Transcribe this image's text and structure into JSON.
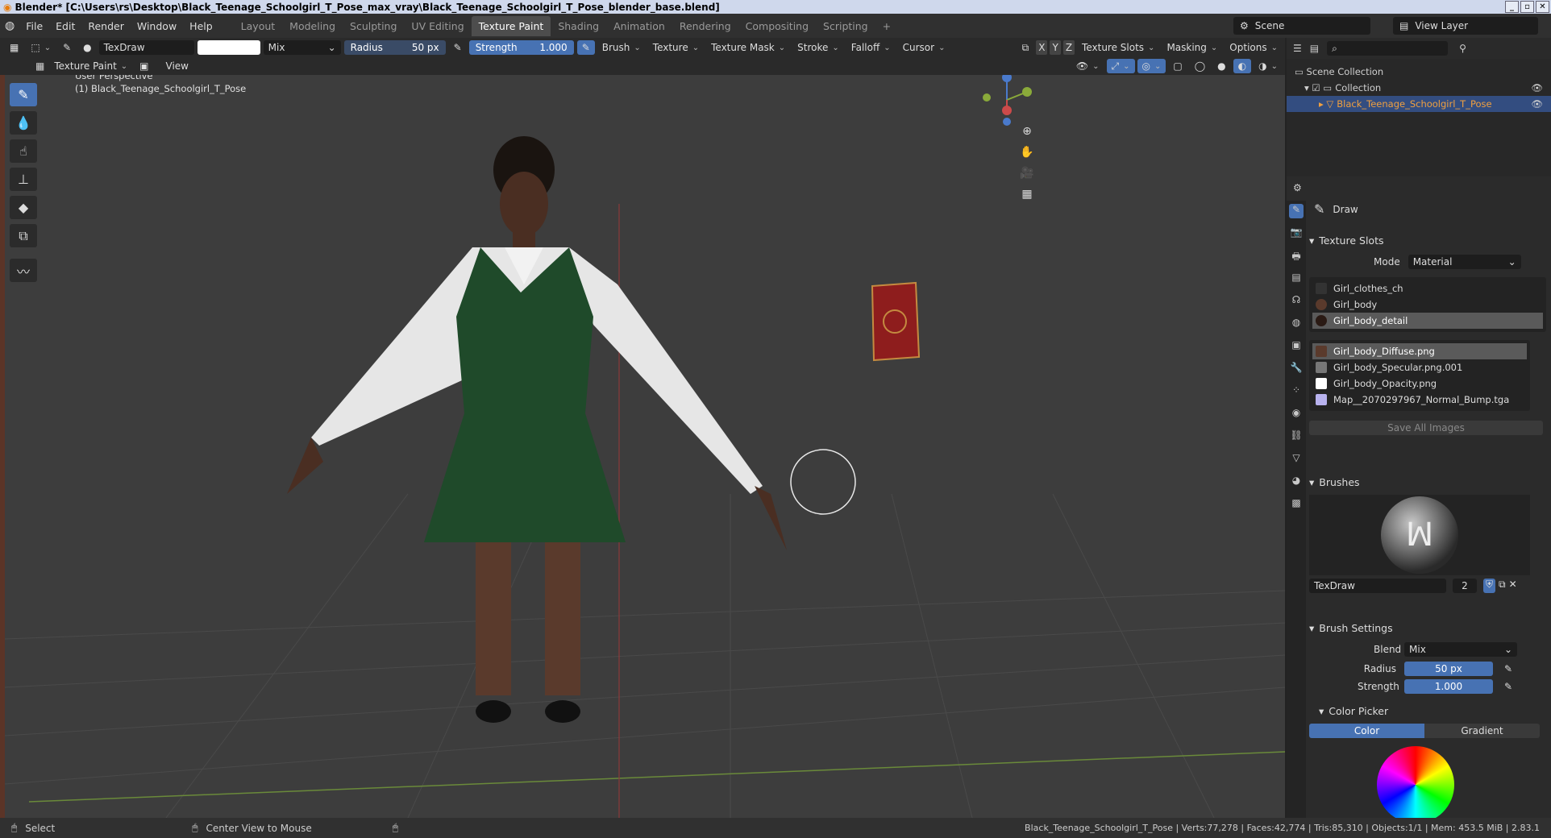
{
  "title": "Blender* [C:\\Users\\rs\\Desktop\\Black_Teenage_Schoolgirl_T_Pose_max_vray\\Black_Teenage_Schoolgirl_T_Pose_blender_base.blend]",
  "menu": [
    "File",
    "Edit",
    "Render",
    "Window",
    "Help"
  ],
  "workspaces": [
    "Layout",
    "Modeling",
    "Sculpting",
    "UV Editing",
    "Texture Paint",
    "Shading",
    "Animation",
    "Rendering",
    "Compositing",
    "Scripting"
  ],
  "active_workspace": "Texture Paint",
  "scene": "Scene",
  "view_layer": "View Layer",
  "tool_header": {
    "brush": "TexDraw",
    "blend": "Mix",
    "radius_label": "Radius",
    "radius_value": "50 px",
    "strength_label": "Strength",
    "strength_value": "1.000",
    "menus": [
      "Brush",
      "Texture",
      "Texture Mask",
      "Stroke",
      "Falloff",
      "Cursor"
    ],
    "axes": [
      "X",
      "Y",
      "Z"
    ],
    "right_menus": [
      "Texture Slots",
      "Masking",
      "Options"
    ]
  },
  "header2": {
    "mode": "Texture Paint",
    "view": "View"
  },
  "viewport": {
    "perspective": "User Perspective",
    "object_label": "(1) Black_Teenage_Schoolgirl_T_Pose"
  },
  "outliner": {
    "scene_collection": "Scene Collection",
    "collection": "Collection",
    "object": "Black_Teenage_Schoolgirl_T_Pose"
  },
  "properties": {
    "tool_name": "Draw",
    "texture_slots_title": "Texture Slots",
    "mode_label": "Mode",
    "mode_value": "Material",
    "materials": [
      "Girl_clothes_ch",
      "Girl_body",
      "Girl_body_detail"
    ],
    "images": [
      "Girl_body_Diffuse.png",
      "Girl_body_Specular.png.001",
      "Girl_body_Opacity.png",
      "Map__2070297967_Normal_Bump.tga"
    ],
    "save_all": "Save All Images",
    "brushes_title": "Brushes",
    "brush_name": "TexDraw",
    "brush_users": "2",
    "brush_settings_title": "Brush Settings",
    "blend_label": "Blend",
    "blend_value": "Mix",
    "radius_label": "Radius",
    "radius_value": "50 px",
    "strength_label": "Strength",
    "strength_value": "1.000",
    "color_picker_title": "Color Picker",
    "color_tab": "Color",
    "gradient_tab": "Gradient"
  },
  "status": {
    "select": "Select",
    "center": "Center View to Mouse",
    "stats": "Black_Teenage_Schoolgirl_T_Pose | Verts:77,278 | Faces:42,774 | Tris:85,310 | Objects:1/1 | Mem: 453.5 MiB | 2.83.1"
  },
  "colors": {
    "accent": "#4772b3",
    "active_object": "#f0a040"
  }
}
